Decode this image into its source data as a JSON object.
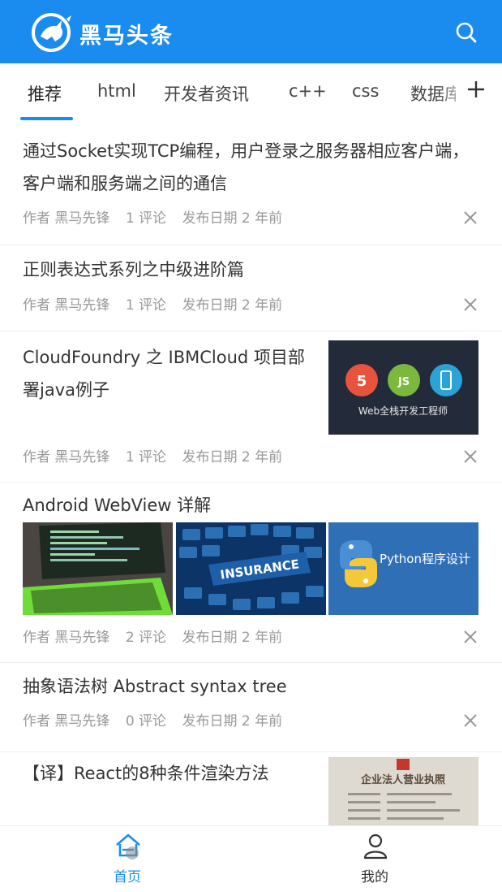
{
  "header": {
    "brand": "黑马头条",
    "logo_icon": "horse-logo-icon",
    "search_icon": "search-icon",
    "color": "#1a8cf0"
  },
  "tabs": [
    {
      "label": "推荐",
      "active": true
    },
    {
      "label": "html",
      "active": false
    },
    {
      "label": "开发者资讯",
      "active": false
    },
    {
      "label": "c++",
      "active": false
    },
    {
      "label": "css",
      "active": false
    },
    {
      "label": "数据库",
      "active": false
    }
  ],
  "tab_add_icon": "plus-icon",
  "articles": [
    {
      "title": "通过Socket实现TCP编程，用户登录之服务器相应客户端，客户端和服务端之间的通信",
      "author": "作者 黑马先锋",
      "comments": "1 评论",
      "date": "发布日期 2 年前",
      "images": []
    },
    {
      "title": "正则表达式系列之中级进阶篇",
      "author": "作者 黑马先锋",
      "comments": "1 评论",
      "date": "发布日期 2 年前",
      "images": []
    },
    {
      "title": "CloudFoundry 之 IBMCloud 项目部署java例子",
      "author": "作者 黑马先锋",
      "comments": "1 评论",
      "date": "发布日期 2 年前",
      "images": [
        {
          "caption": "Web全栈开发工程师",
          "badges": [
            "5",
            "JS",
            "📱"
          ]
        }
      ]
    },
    {
      "title": "Android WebView 详解",
      "author": "作者 黑马先锋",
      "comments": "2 评论",
      "date": "发布日期 2 年前",
      "images": [
        {
          "caption": ""
        },
        {
          "caption": "INSURANCE"
        },
        {
          "caption": "Python程序设计"
        }
      ]
    },
    {
      "title": "抽象语法树 Abstract syntax tree",
      "author": "作者 黑马先锋",
      "comments": "0 评论",
      "date": "发布日期 2 年前",
      "images": []
    },
    {
      "title": "【译】React的8种条件渲染方法",
      "author": "",
      "comments": "",
      "date": "",
      "images": [
        {
          "caption": "企业法人营业执照"
        }
      ]
    }
  ],
  "tabbar": [
    {
      "label": "首页",
      "icon": "home-icon",
      "active": true
    },
    {
      "label": "我的",
      "icon": "user-icon",
      "active": false
    }
  ]
}
